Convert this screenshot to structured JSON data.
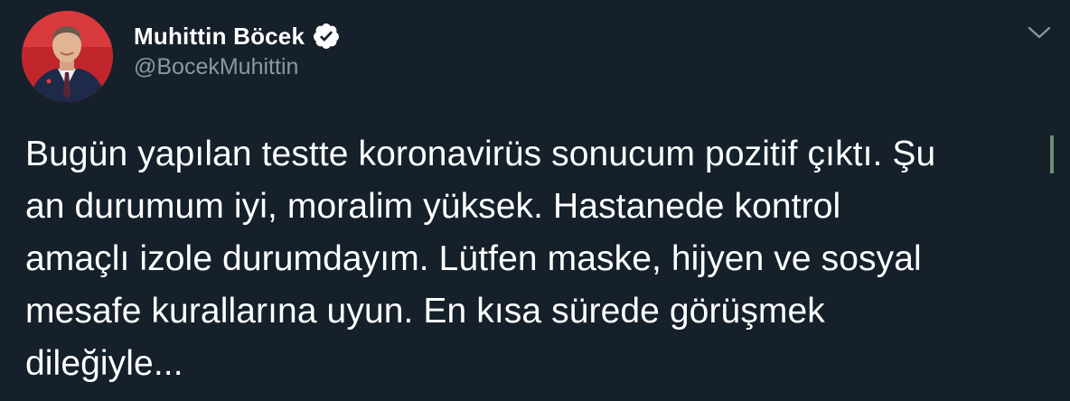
{
  "user": {
    "display_name": "Muhittin Böcek",
    "handle": "@BocekMuhittin",
    "verified": true,
    "avatar_icon": "profile-photo"
  },
  "menu_icon": "chevron-down-icon",
  "tweet": {
    "text": "Bugün yapılan testte koronavirüs sonucum pozitif çıktı. Şu\nan durumum iyi, moralim yüksek. Hastanede kontrol\namaçlı izole durumdayım. Lütfen maske, hijyen ve sosyal\nmesafe kurallarına uyun. En kısa sürede görüşmek\ndileğiyle..."
  },
  "colors": {
    "background": "#15202b",
    "text_primary": "#ffffff",
    "text_secondary": "#8899a6",
    "verified_badge": "#ffffff"
  }
}
